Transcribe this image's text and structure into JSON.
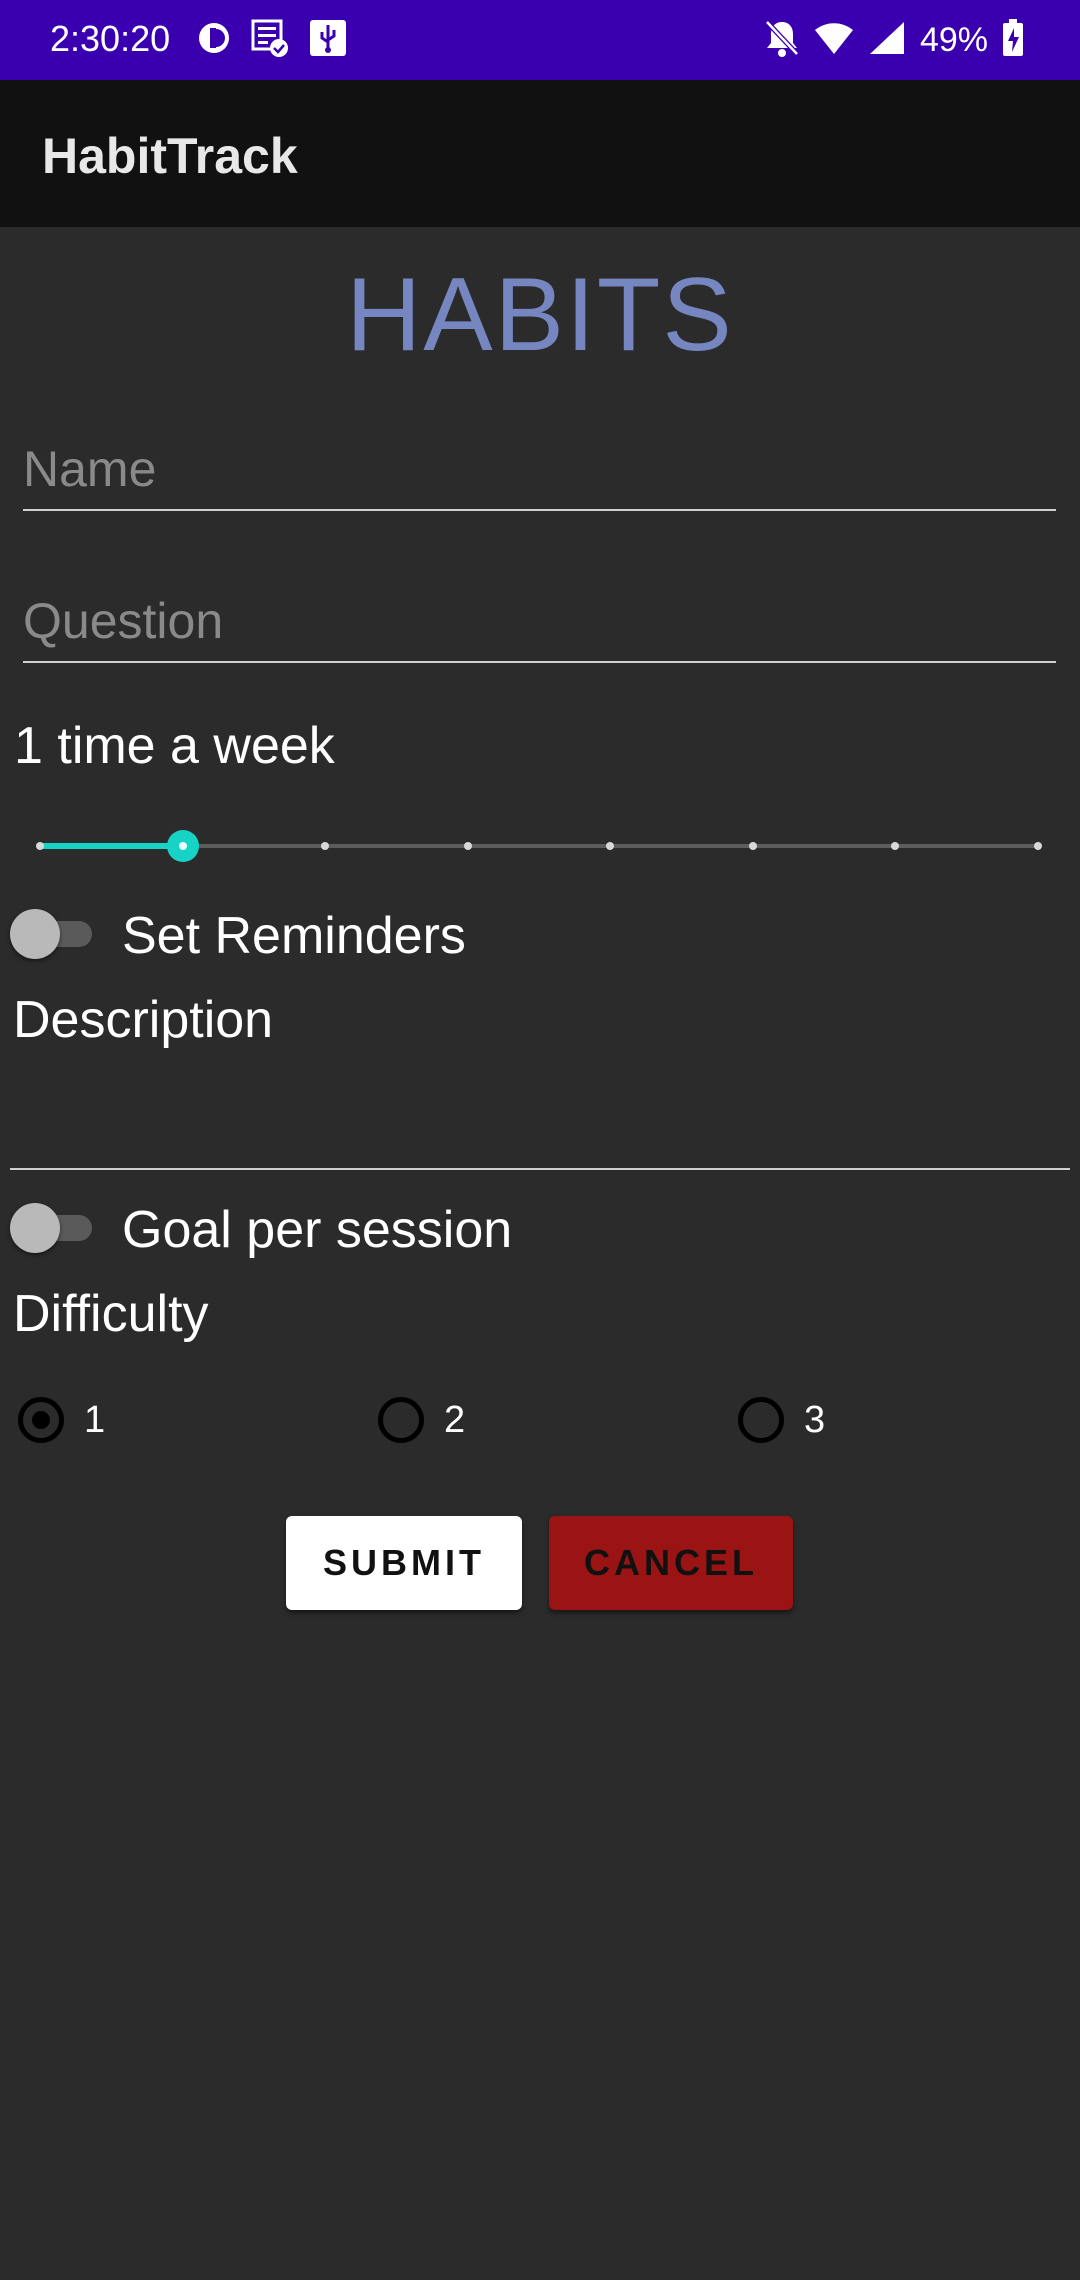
{
  "status_bar": {
    "time": "2:30:20",
    "battery": "49%",
    "icons": [
      "app-circle-icon",
      "document-check-icon",
      "usb-icon",
      "notifications-off-icon",
      "wifi-icon",
      "signal-icon",
      "battery-charging-icon"
    ]
  },
  "app_bar": {
    "title": "HabitTrack"
  },
  "heading": "HABITS",
  "form": {
    "name": {
      "placeholder": "Name",
      "value": ""
    },
    "question": {
      "placeholder": "Question",
      "value": ""
    },
    "frequency_label": "1 time a week",
    "frequency_slider": {
      "value": 1,
      "min": 0,
      "max": 7
    },
    "reminders": {
      "label": "Set Reminders",
      "checked": false
    },
    "description": {
      "label": "Description",
      "value": ""
    },
    "goal": {
      "label": "Goal per session",
      "checked": false
    },
    "difficulty": {
      "label": "Difficulty",
      "options": [
        "1",
        "2",
        "3"
      ],
      "selected": "1"
    }
  },
  "buttons": {
    "submit": "SUBMIT",
    "cancel": "CANCEL"
  },
  "colors": {
    "status_bar": "#3a00b0",
    "app_bar": "#111111",
    "background": "#2b2b2b",
    "heading": "#7686c0",
    "accent": "#17d3c5",
    "cancel": "#9a1414"
  }
}
